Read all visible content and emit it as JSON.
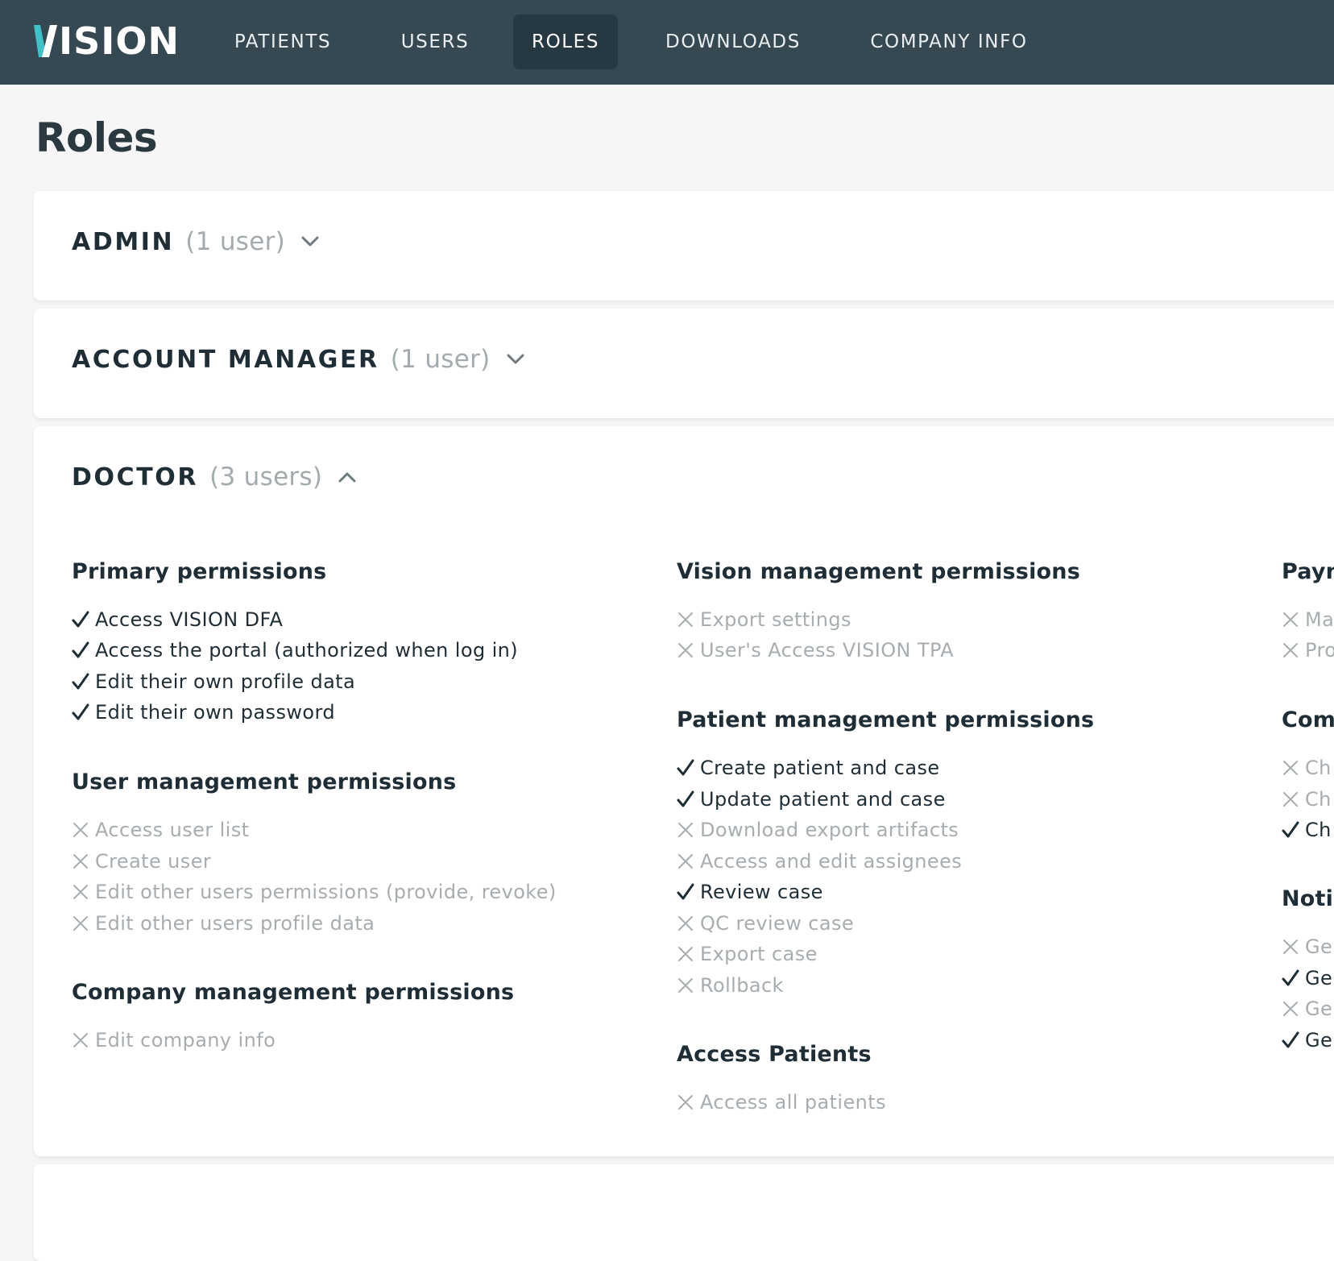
{
  "app": {
    "logo_v": "V",
    "logo_rest": "ISION",
    "accent_color": "#3ec1c9"
  },
  "nav": [
    {
      "label": "PATIENTS"
    },
    {
      "label": "USERS"
    },
    {
      "label": "ROLES",
      "active": true
    },
    {
      "label": "DOWNLOADS"
    },
    {
      "label": "COMPANY INFO"
    }
  ],
  "page": {
    "title": "Roles"
  },
  "roles": [
    {
      "name": "ADMIN",
      "count": "(1 user)",
      "expanded": false
    },
    {
      "name": "ACCOUNT MANAGER",
      "count": "(1 user)",
      "expanded": false
    },
    {
      "name": "DOCTOR",
      "count": "(3 users)",
      "expanded": true,
      "permissions": [
        {
          "title": "Primary permissions",
          "items": [
            {
              "label": "Access VISION DFA",
              "granted": true
            },
            {
              "label": "Access the portal (authorized when log in)",
              "granted": true
            },
            {
              "label": "Edit their own profile data",
              "granted": true
            },
            {
              "label": "Edit their own password",
              "granted": true
            }
          ]
        },
        {
          "title": "User management permissions",
          "items": [
            {
              "label": "Access user list",
              "granted": false
            },
            {
              "label": "Create user",
              "granted": false
            },
            {
              "label": "Edit other users permissions (provide, revoke)",
              "granted": false
            },
            {
              "label": "Edit other users profile data",
              "granted": false
            }
          ]
        },
        {
          "title": "Company management permissions",
          "items": [
            {
              "label": "Edit company info",
              "granted": false
            }
          ]
        },
        {
          "title": "Vision management permissions",
          "items": [
            {
              "label": "Export settings",
              "granted": false
            },
            {
              "label": "User's Access VISION TPA",
              "granted": false
            }
          ]
        },
        {
          "title": "Patient management permissions",
          "items": [
            {
              "label": "Create patient and case",
              "granted": true
            },
            {
              "label": "Update patient and case",
              "granted": true
            },
            {
              "label": "Download export artifacts",
              "granted": false
            },
            {
              "label": "Access and edit assignees",
              "granted": false
            },
            {
              "label": "Review case",
              "granted": true
            },
            {
              "label": "QC review case",
              "granted": false
            },
            {
              "label": "Export case",
              "granted": false
            },
            {
              "label": "Rollback",
              "granted": false
            }
          ]
        },
        {
          "title": "Access Patients",
          "items": [
            {
              "label": "Access all patients",
              "granted": false
            }
          ]
        },
        {
          "title": "Payn",
          "items": [
            {
              "label": "Ma",
              "granted": false
            },
            {
              "label": "Pro",
              "granted": false
            }
          ]
        },
        {
          "title": "Com",
          "items": [
            {
              "label": "Ch",
              "granted": false
            },
            {
              "label": "Ch",
              "granted": false
            },
            {
              "label": "Ch",
              "granted": true
            }
          ]
        },
        {
          "title": "Noti",
          "items": [
            {
              "label": "Ge",
              "granted": false
            },
            {
              "label": "Ge",
              "granted": true
            },
            {
              "label": "Ge",
              "granted": false
            },
            {
              "label": "Ge",
              "granted": true
            }
          ]
        }
      ]
    }
  ]
}
